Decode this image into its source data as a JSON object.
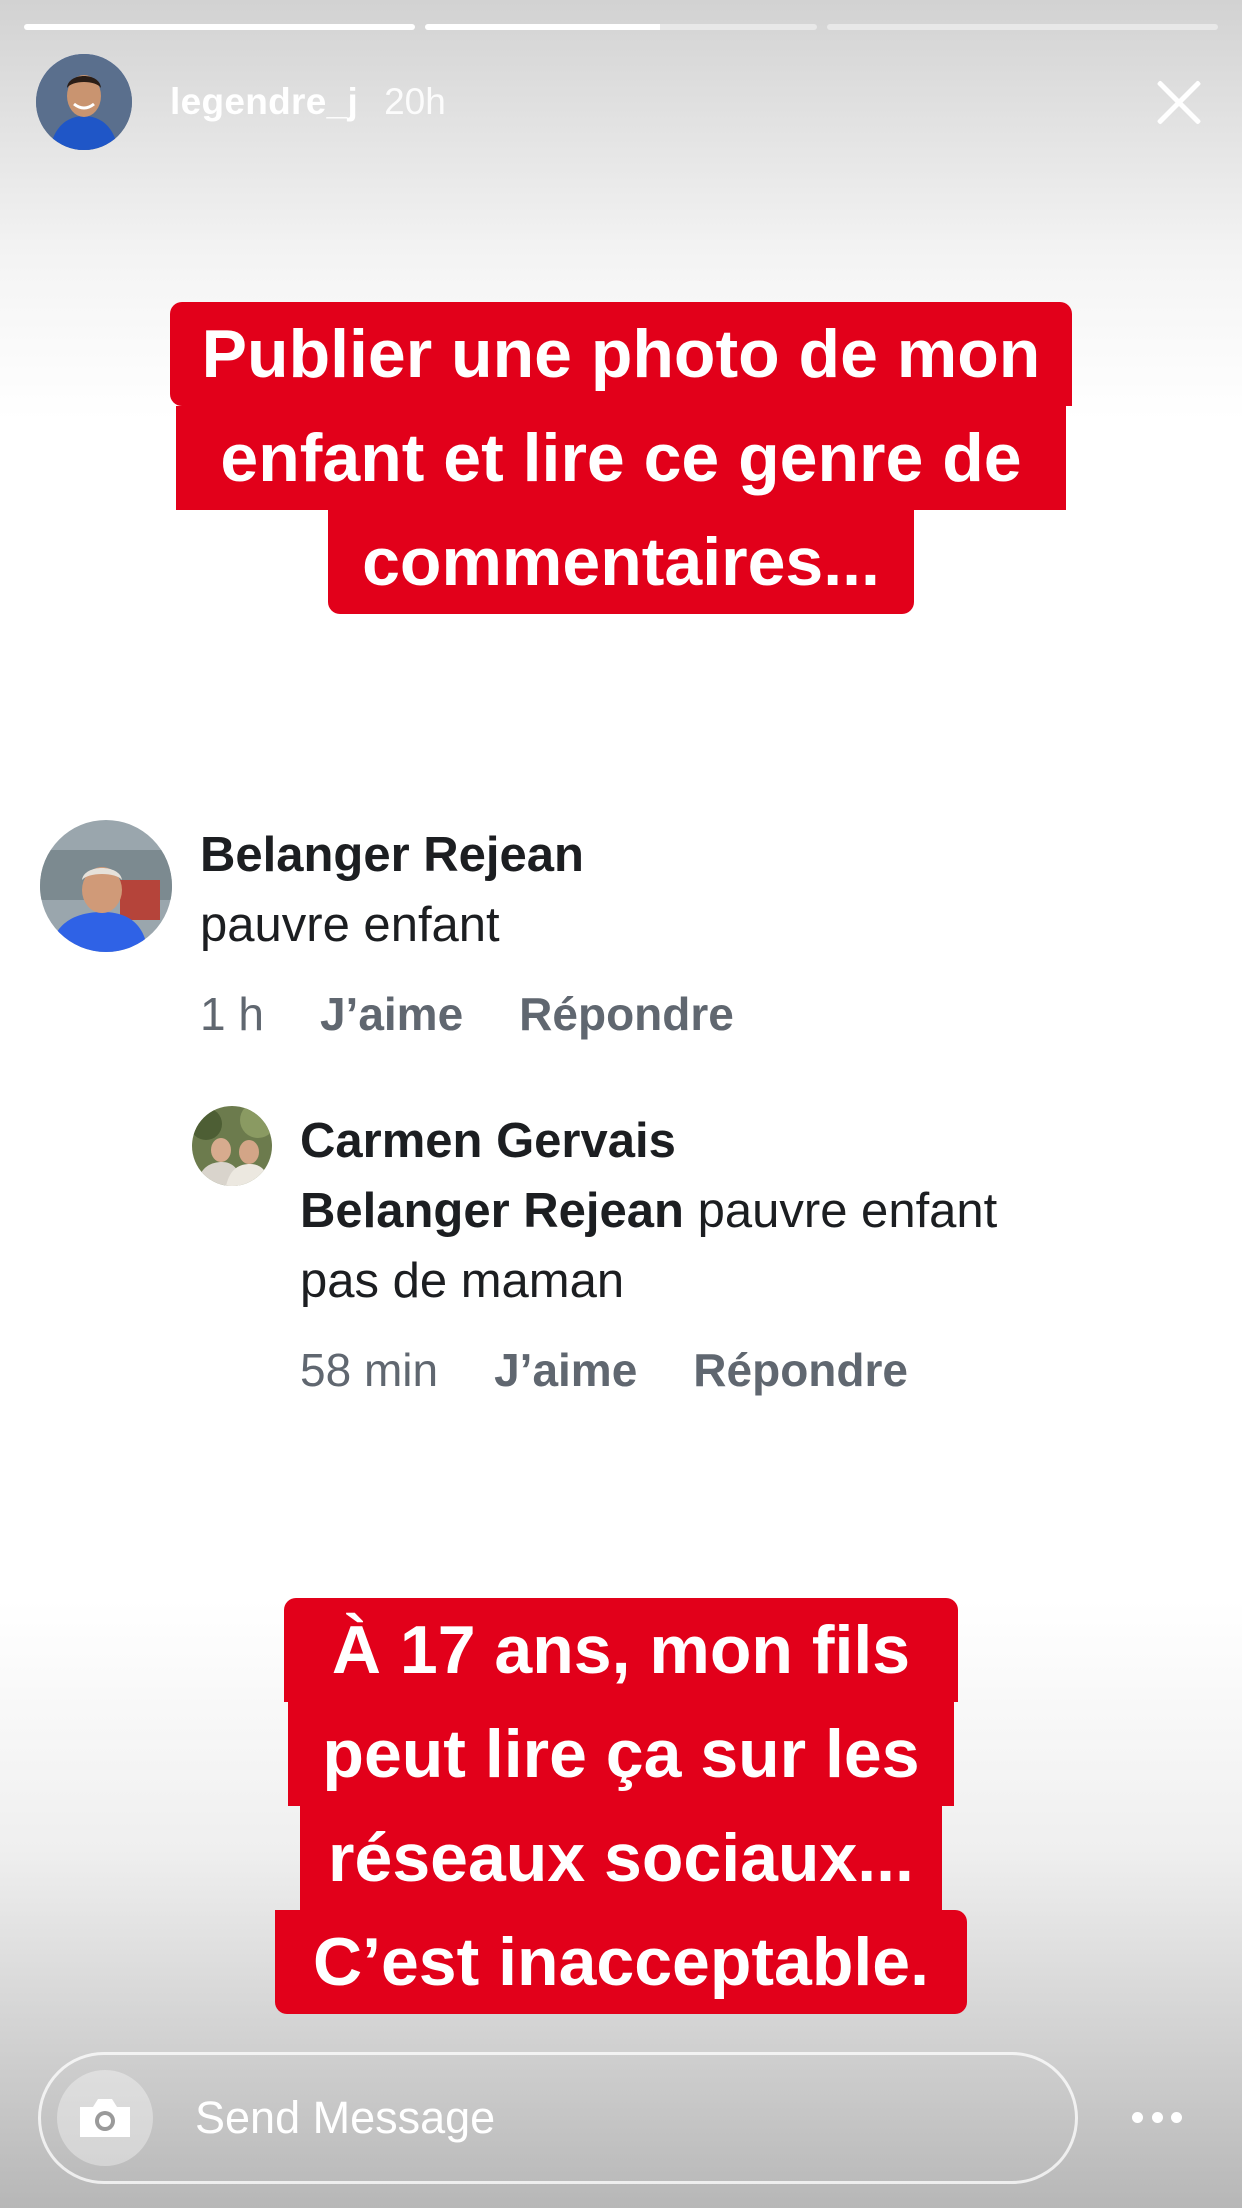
{
  "story": {
    "progress": [
      1.0,
      0.6,
      0.0
    ],
    "username": "legendre_j",
    "time": "20h"
  },
  "caption_top": [
    "Publier une photo de mon",
    "enfant et lire ce genre de",
    "commentaires..."
  ],
  "comments": [
    {
      "author": "Belanger Rejean",
      "text": "pauvre enfant",
      "time": "1 h",
      "like": "J’aime",
      "reply": "Répondre"
    },
    {
      "author": "Carmen Gervais",
      "mention": "Belanger Rejean",
      "text_inline": "pauvre enfant",
      "text_line2": "pas de maman",
      "time": "58 min",
      "like": "J’aime",
      "reply": "Répondre"
    }
  ],
  "caption_bottom": [
    "À 17 ans, mon fils",
    "peut lire ça sur les",
    "réseaux sociaux...",
    "C’est inacceptable."
  ],
  "message": {
    "placeholder": "Send Message"
  },
  "icons": {
    "close": "close-icon",
    "camera": "camera-icon",
    "more": "more-horizontal-icon"
  },
  "colors": {
    "caption_bg": "#e2001a",
    "caption_text": "#ffffff",
    "comment_meta": "#606770"
  }
}
